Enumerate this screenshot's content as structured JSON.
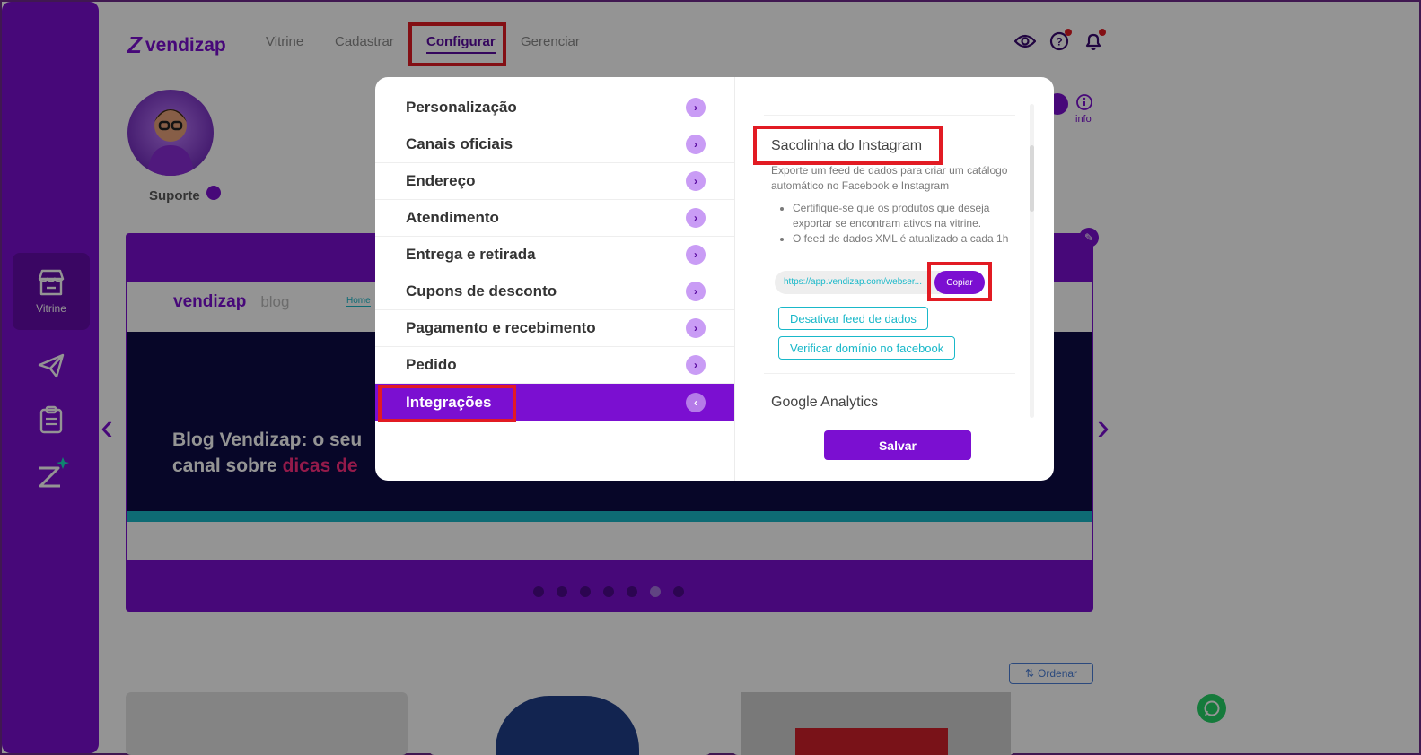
{
  "nav": {
    "logo": "vendizap",
    "items": [
      "Vitrine",
      "Cadastrar",
      "Configurar",
      "Gerenciar"
    ],
    "active": "Configurar"
  },
  "sidebar": {
    "active_label": "Vitrine"
  },
  "profile": {
    "name": "Suporte"
  },
  "top_right": {
    "info_label": "info"
  },
  "banner": {
    "blog_logo": "vendizap",
    "blog_word": "blog",
    "home_link": "Home",
    "headline_line1": "Blog Vendizap: o seu",
    "headline_line2_white": "canal sobre ",
    "headline_line2_pink": "dicas de"
  },
  "ordenar": "Ordenar",
  "modal": {
    "menu": [
      {
        "label": "Personalização"
      },
      {
        "label": "Canais oficiais"
      },
      {
        "label": "Endereço"
      },
      {
        "label": "Atendimento"
      },
      {
        "label": "Entrega e retirada"
      },
      {
        "label": "Cupons de desconto"
      },
      {
        "label": "Pagamento e recebimento"
      },
      {
        "label": "Pedido"
      },
      {
        "label": "Integrações"
      }
    ],
    "active_index": 8,
    "section_title": "Sacolinha do Instagram",
    "section_desc": "Exporte um feed de dados para criar um catálogo automático no Facebook e Instagram",
    "bullets": [
      "Certifique-se que os produtos que deseja exportar se encontram ativos na vitrine.",
      "O feed de dados XML é atualizado a cada 1h"
    ],
    "feed_url": "https://app.vendizap.com/webser...",
    "copy_label": "Copiar",
    "disable_feed": "Desativar feed de dados",
    "verify_domain": "Verificar domínio no facebook",
    "next_section": "Google Analytics",
    "save_label": "Salvar"
  },
  "colors": {
    "brand": "#7b0fd1",
    "accent_teal": "#19b8c9",
    "highlight": "#e21b23"
  },
  "icons": [
    "store-icon",
    "send-icon",
    "clipboard-icon",
    "vendizap-star-icon",
    "eye-icon",
    "help-icon",
    "bell-icon",
    "filter-icon",
    "info-icon",
    "edit-icon",
    "whatsapp-icon"
  ]
}
